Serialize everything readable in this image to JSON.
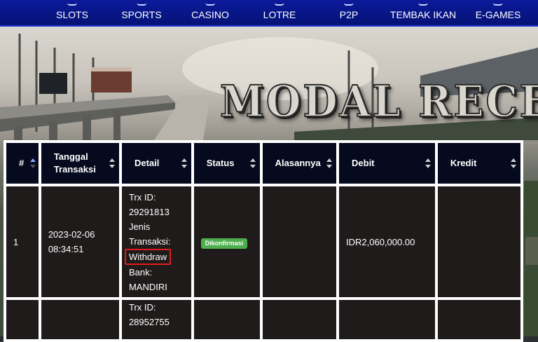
{
  "nav": {
    "items": [
      "SLOTS",
      "SPORTS",
      "CASINO",
      "LOTRE",
      "P2P",
      "TEMBAK IKAN",
      "E-GAMES"
    ]
  },
  "banner": {
    "brand": "MODAL RECEH"
  },
  "table": {
    "headers": [
      "#",
      "Tanggal Transaksi",
      "Detail",
      "Status",
      "Alasannya",
      "Debit",
      "Kredit"
    ],
    "rows": [
      {
        "no": "1",
        "date": "2023-02-06",
        "time": "08:34:51",
        "trx_label": "Trx ID:",
        "trx_id": "29291813",
        "jenis_label": "Jenis",
        "transaksi_label": "Transaksi:",
        "jenis_value": "Withdraw",
        "bank_label": "Bank:",
        "bank_value": "MANDIRI",
        "status": "Dikonfirmasi",
        "reason": "",
        "debit": "IDR2,060,000.00",
        "kredit": ""
      },
      {
        "no": "",
        "trx_label": "Trx ID:",
        "trx_id": "28952755"
      }
    ]
  },
  "colors": {
    "nav_bg": "#0a1a9a",
    "header_bg": "#060a1e",
    "cell_bg": "#1f1b1b",
    "status_green": "#4cae4c",
    "highlight_red": "#e21c1c"
  }
}
